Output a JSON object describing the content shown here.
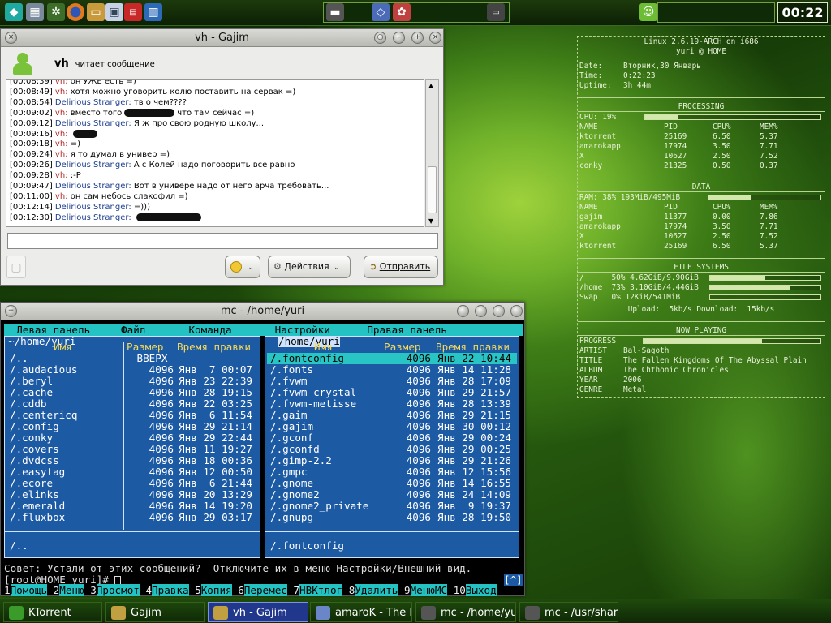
{
  "top_panel": {
    "clock": "00:22",
    "launchers": [
      "gem-icon",
      "calculator-icon",
      "settings-icon",
      "firefox-icon",
      "disk-icon",
      "image-icon",
      "calendar-icon",
      "editor-icon"
    ]
  },
  "gajim": {
    "title": "vh - Gajim",
    "contact_name": "vh",
    "contact_status": "читает сообщение",
    "messages": [
      {
        "t": "[00:08:39]",
        "n": "vh:",
        "who": "vh",
        "m": "он УЖЕ есть =)"
      },
      {
        "t": "[00:08:49]",
        "n": "vh:",
        "who": "vh",
        "m": "хотя можно уговорить колю поставить на сервак =)"
      },
      {
        "t": "[00:08:54]",
        "n": "Delirious Stranger:",
        "who": "ds",
        "m": "тв о чем????"
      },
      {
        "t": "[00:09:02]",
        "n": "vh:",
        "who": "vh",
        "m": "вместо того",
        "after": "что там сейчас =)",
        "redact": true
      },
      {
        "t": "[00:09:12]",
        "n": "Delirious Stranger:",
        "who": "ds",
        "m": "Я ж про свою родную школу..."
      },
      {
        "t": "[00:09:16]",
        "n": "vh:",
        "who": "vh",
        "m": "",
        "redact": true
      },
      {
        "t": "[00:09:18]",
        "n": "vh:",
        "who": "vh",
        "m": "=)"
      },
      {
        "t": "[00:09:24]",
        "n": "vh:",
        "who": "vh",
        "m": "я то думал в универ =)"
      },
      {
        "t": "[00:09:26]",
        "n": "Delirious Stranger:",
        "who": "ds",
        "m": "А с Колей надо поговорить все равно"
      },
      {
        "t": "[00:09:28]",
        "n": "vh:",
        "who": "vh",
        "m": ":-P"
      },
      {
        "t": "[00:09:47]",
        "n": "Delirious Stranger:",
        "who": "ds",
        "m": "Вот в универе надо от него арча требовать..."
      },
      {
        "t": "[00:11:00]",
        "n": "vh:",
        "who": "vh",
        "m": "он сам небось слакофил =)"
      },
      {
        "t": "[00:12:14]",
        "n": "Delirious Stranger:",
        "who": "ds",
        "m": "=)))"
      },
      {
        "t": "[00:12:30]",
        "n": "Delirious Stranger:",
        "who": "ds",
        "m": "",
        "redact": true
      }
    ],
    "input_value": "",
    "emoticon_label": "",
    "actions_label": "Действия",
    "send_label": "Отправить"
  },
  "mc": {
    "title": "mc - /home/yuri",
    "menu": "  Левая панель     Файл       Команда       Настройки      Правая панель",
    "left": {
      "path": "~/home/yuri",
      "headers": {
        "name": "Имя",
        "size": "Размер",
        "time": "Время правки"
      },
      "rows": [
        {
          "name": "/..",
          "size": "-ВВЕРХ-",
          "time": ""
        },
        {
          "name": "/.audacious",
          "size": "4096",
          "time": "Янв  7 00:07"
        },
        {
          "name": "/.beryl",
          "size": "4096",
          "time": "Янв 23 22:39"
        },
        {
          "name": "/.cache",
          "size": "4096",
          "time": "Янв 28 19:15"
        },
        {
          "name": "/.cddb",
          "size": "4096",
          "time": "Янв 22 03:25"
        },
        {
          "name": "/.centericq",
          "size": "4096",
          "time": "Янв  6 11:54"
        },
        {
          "name": "/.config",
          "size": "4096",
          "time": "Янв 29 21:14"
        },
        {
          "name": "/.conky",
          "size": "4096",
          "time": "Янв 29 22:44"
        },
        {
          "name": "/.covers",
          "size": "4096",
          "time": "Янв 11 19:27"
        },
        {
          "name": "/.dvdcss",
          "size": "4096",
          "time": "Янв 18 00:36"
        },
        {
          "name": "/.easytag",
          "size": "4096",
          "time": "Янв 12 00:50"
        },
        {
          "name": "/.ecore",
          "size": "4096",
          "time": "Янв  6 21:44"
        },
        {
          "name": "/.elinks",
          "size": "4096",
          "time": "Янв 20 13:29"
        },
        {
          "name": "/.emerald",
          "size": "4096",
          "time": "Янв 14 19:20"
        },
        {
          "name": "/.fluxbox",
          "size": "4096",
          "time": "Янв 29 03:17"
        }
      ],
      "bottom": "/.."
    },
    "right": {
      "path": "/home/yuri",
      "headers": {
        "name": "Имя",
        "size": "Размер",
        "time": "Время правки"
      },
      "rows": [
        {
          "name": "/.fontconfig",
          "size": "4096",
          "time": "Янв 22 10:44",
          "sel": true
        },
        {
          "name": "/.fonts",
          "size": "4096",
          "time": "Янв 14 11:28"
        },
        {
          "name": "/.fvwm",
          "size": "4096",
          "time": "Янв 28 17:09"
        },
        {
          "name": "/.fvwm-crystal",
          "size": "4096",
          "time": "Янв 29 21:57"
        },
        {
          "name": "/.fvwm-metisse",
          "size": "4096",
          "time": "Янв 28 13:39"
        },
        {
          "name": "/.gaim",
          "size": "4096",
          "time": "Янв 29 21:15"
        },
        {
          "name": "/.gajim",
          "size": "4096",
          "time": "Янв 30 00:12"
        },
        {
          "name": "/.gconf",
          "size": "4096",
          "time": "Янв 29 00:24"
        },
        {
          "name": "/.gconfd",
          "size": "4096",
          "time": "Янв 29 00:25"
        },
        {
          "name": "/.gimp-2.2",
          "size": "4096",
          "time": "Янв 29 21:26"
        },
        {
          "name": "/.gmpc",
          "size": "4096",
          "time": "Янв 12 15:56"
        },
        {
          "name": "/.gnome",
          "size": "4096",
          "time": "Янв 14 16:55"
        },
        {
          "name": "/.gnome2",
          "size": "4096",
          "time": "Янв 24 14:09"
        },
        {
          "name": "/.gnome2_private",
          "size": "4096",
          "time": "Янв  9 19:37"
        },
        {
          "name": "/.gnupg",
          "size": "4096",
          "time": "Янв 28 19:50"
        }
      ],
      "bottom": "/.fontconfig"
    },
    "tip": "Совет: Устали от этих сообщений?  Отключите их в меню Настройки/Внешний вид.",
    "prompt": "[root@HOME yuri]# ",
    "prompt_right": "[^]",
    "fkeys": [
      {
        "n": "1",
        "l": "Помощь"
      },
      {
        "n": "2",
        "l": "Меню"
      },
      {
        "n": "3",
        "l": "Просмот"
      },
      {
        "n": "4",
        "l": "Правка"
      },
      {
        "n": "5",
        "l": "Копия"
      },
      {
        "n": "6",
        "l": "Перемес"
      },
      {
        "n": "7",
        "l": "НВКтлог"
      },
      {
        "n": "8",
        "l": "Удалить"
      },
      {
        "n": "9",
        "l": "МенюМС"
      },
      {
        "n": "10",
        "l": "Выход"
      }
    ]
  },
  "conky": {
    "kernel": "Linux 2.6.19-ARCH on i686",
    "host": "yuri @ HOME",
    "date_label": "Date:",
    "date": "Вторник,30 Январь",
    "time_label": "Time:",
    "time": "0:22:23",
    "uptime_label": "Uptime:",
    "uptime": "3h 44m",
    "processing_title": "PROCESSING",
    "cpu_label": "CPU: 19%",
    "cpu_fraction": 0.19,
    "proc_headers": [
      "NAME",
      "PID",
      "CPU%",
      "MEM%"
    ],
    "proc_rows": [
      [
        "ktorrent",
        "25169",
        "6.50",
        "5.37"
      ],
      [
        "amarokapp",
        "17974",
        "3.50",
        "7.71"
      ],
      [
        "X",
        "10627",
        "2.50",
        "7.52"
      ],
      [
        "conky",
        "21325",
        "0.50",
        "0.37"
      ]
    ],
    "data_title": "DATA",
    "ram_label": "RAM: 38% 193MiB/495MiB",
    "ram_fraction": 0.38,
    "mem_headers": [
      "NAME",
      "PID",
      "CPU%",
      "MEM%"
    ],
    "mem_rows": [
      [
        "gajim",
        "11377",
        "0.00",
        "7.86"
      ],
      [
        "amarokapp",
        "17974",
        "3.50",
        "7.71"
      ],
      [
        "X",
        "10627",
        "2.50",
        "7.52"
      ],
      [
        "ktorrent",
        "25169",
        "6.50",
        "5.37"
      ]
    ],
    "fs_title": "FILE SYSTEMS",
    "fs_rows": [
      {
        "label": "/      50% 4.62GiB/9.90GiB",
        "fraction": 0.5
      },
      {
        "label": "/home  73% 3.10GiB/4.44GiB",
        "fraction": 0.73
      },
      {
        "label": "Swap   0% 12KiB/541MiB",
        "fraction": 0.0
      }
    ],
    "net": "Upload:  5kb/s Download:  15kb/s",
    "np_title": "NOW PLAYING",
    "progress_label": "PROGRESS",
    "progress_fraction": 0.67,
    "np_rows": [
      [
        "ARTIST",
        "Bal-Sagoth"
      ],
      [
        "TITLE",
        "The Fallen Kingdoms Of The Abyssal Plain"
      ],
      [
        "ALBUM",
        "The Chthonic Chronicles"
      ],
      [
        "YEAR",
        "2006"
      ],
      [
        "GENRE",
        "Metal"
      ]
    ]
  },
  "taskbar": {
    "tasks": [
      {
        "label": "KTorrent",
        "icon": "ktorrent-icon"
      },
      {
        "label": "Gajim",
        "icon": "gajim-icon"
      },
      {
        "label": "vh - Gajim",
        "icon": "gajim-icon",
        "active": true
      },
      {
        "label": "amaroK - The Fa",
        "icon": "amarok-icon"
      },
      {
        "label": "mc - /home/yuri",
        "icon": "terminal-icon"
      },
      {
        "label": "mc - /usr/share",
        "icon": "terminal-icon"
      }
    ]
  }
}
